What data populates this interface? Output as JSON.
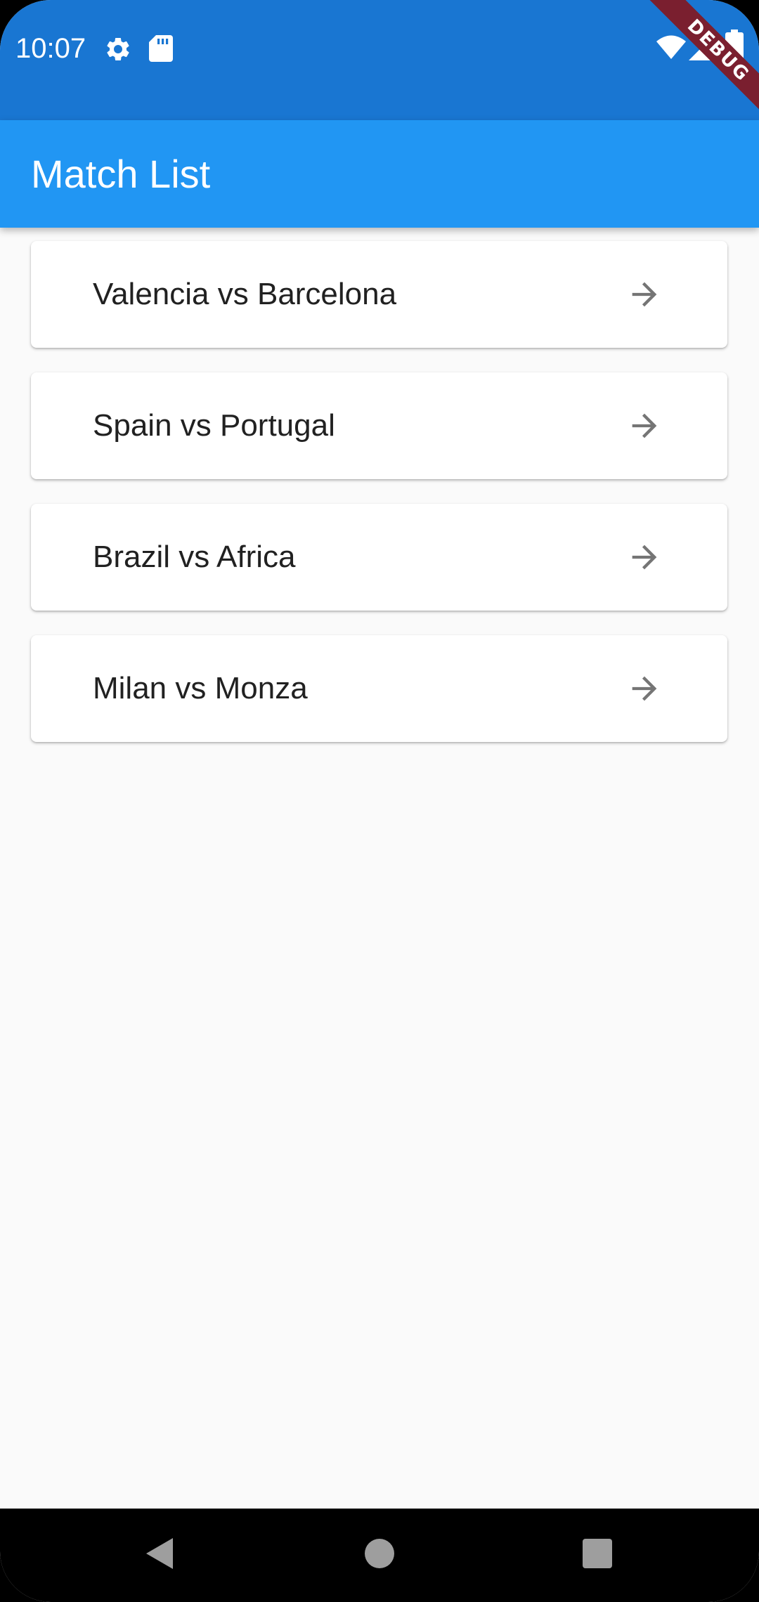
{
  "status_bar": {
    "time": "10:07",
    "left_icons": [
      "gear-icon",
      "sd-card-icon"
    ],
    "right_icons": [
      "wifi-icon",
      "cell-signal-icon",
      "battery-icon"
    ]
  },
  "debug_banner": "DEBUG",
  "app_bar": {
    "title": "Match List"
  },
  "matches": [
    {
      "label": "Valencia vs Barcelona",
      "icon": "arrow-right-icon"
    },
    {
      "label": "Spain vs Portugal",
      "icon": "arrow-right-icon"
    },
    {
      "label": "Brazil vs Africa",
      "icon": "arrow-right-icon"
    },
    {
      "label": "Milan vs Monza",
      "icon": "arrow-right-icon"
    }
  ],
  "nav_bar": {
    "buttons": [
      "back-icon",
      "home-icon",
      "recents-icon"
    ]
  },
  "colors": {
    "status_bar": "#1976d2",
    "app_bar": "#2196f3",
    "background": "#fafafa",
    "card": "#ffffff",
    "text": "#212121",
    "arrow": "#757575"
  }
}
